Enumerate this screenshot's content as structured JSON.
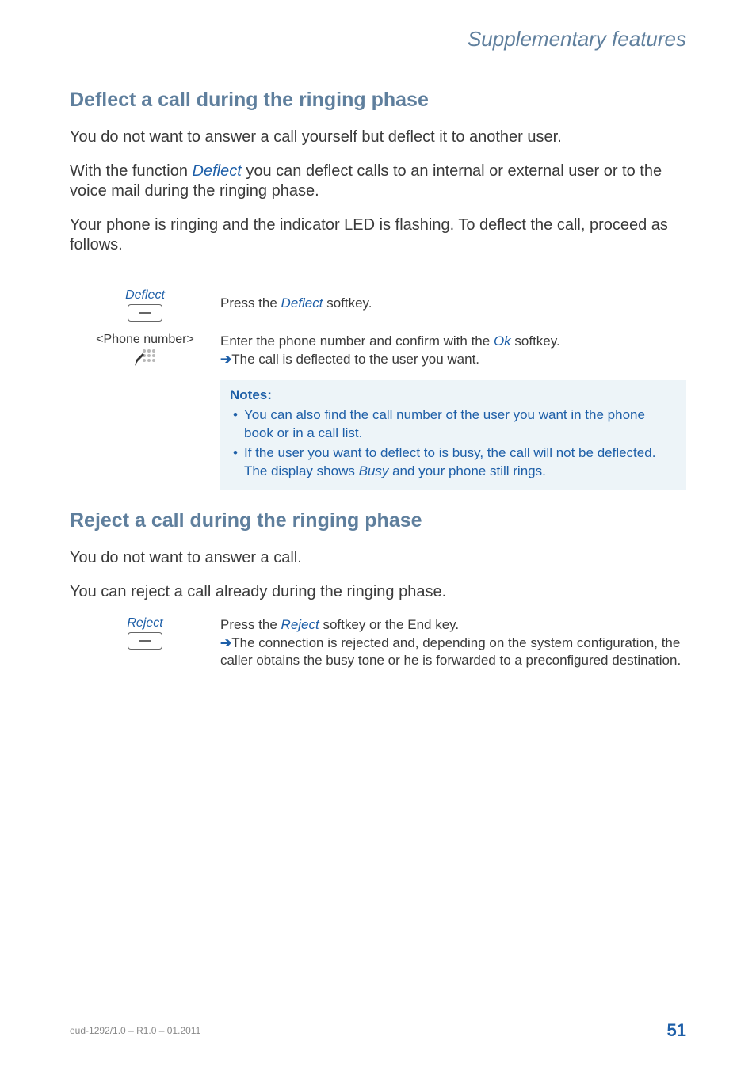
{
  "chapter": "Supplementary features",
  "section1": {
    "heading": "Deflect a call during the ringing phase",
    "para1": "You do not want to answer a call yourself but deflect it to another user.",
    "para2_a": "With the function ",
    "para2_em": "Deflect",
    "para2_b": " you can deflect calls to an internal or external user or to the voice mail during the ringing phase.",
    "para3": "Your phone is ringing and the indicator LED is flashing. To deflect the call, proceed as follows.",
    "step1": {
      "caption": "Deflect",
      "text_a": "Press the ",
      "text_em": "Deflect",
      "text_b": " softkey."
    },
    "step2": {
      "caption": "<Phone number>",
      "line1_a": "Enter the phone number and confirm with the ",
      "line1_em": "Ok",
      "line1_b": " softkey.",
      "line2": "The call is deflected to the user you want."
    },
    "notes": {
      "title": "Notes:",
      "item1": "You can also find the call number of the user you want in the phone book or in a call list.",
      "item2_a": "If the user you want to deflect to is busy, the call will not be deflected. The display shows ",
      "item2_em": "Busy",
      "item2_b": " and your phone still rings."
    }
  },
  "section2": {
    "heading": "Reject a call during the ringing phase",
    "para1": "You do not want to answer a call.",
    "para2": "You can reject a call already during the ringing phase.",
    "step1": {
      "caption": "Reject",
      "line1_a": "Press the ",
      "line1_em": "Reject",
      "line1_b": " softkey or the End key.",
      "line2": "The connection is rejected and, depending on the system configuration, the caller obtains the busy tone or he is forwarded to a preconfigured destination."
    }
  },
  "footer": {
    "left": "eud-1292/1.0 – R1.0 – 01.2011",
    "page": "51"
  }
}
